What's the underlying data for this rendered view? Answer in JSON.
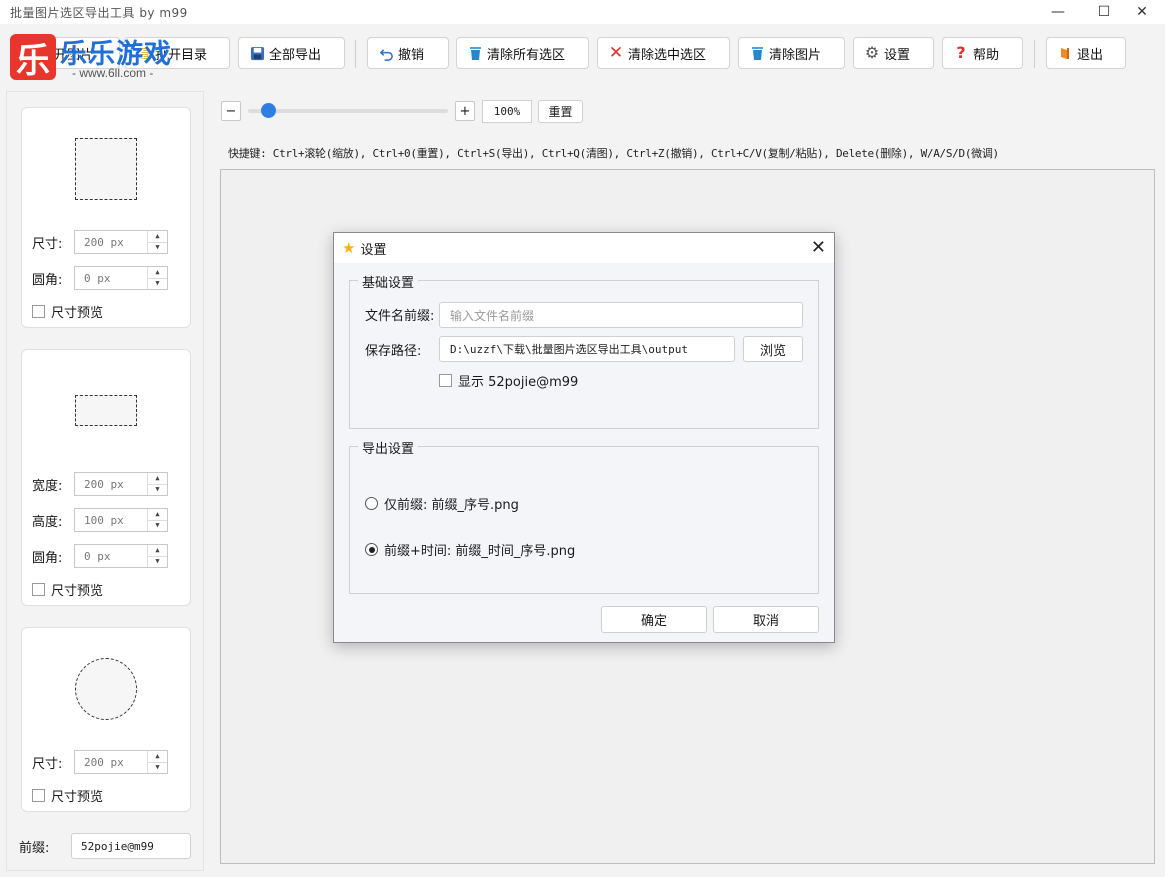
{
  "window": {
    "title": "批量图片选区导出工具 by m99",
    "minimize_glyph": "—",
    "maximize_glyph": "☐",
    "close_glyph": "✕"
  },
  "watermark": {
    "logo_char": "乐",
    "brand": "乐乐游戏",
    "url": "- www.6ll.com -"
  },
  "toolbar": {
    "buttons": [
      {
        "label": "打开图片",
        "icon": "folder-icon"
      },
      {
        "label": "打开目录",
        "icon": "folder-open-icon"
      },
      {
        "label": "全部导出",
        "icon": "save-icon"
      },
      {
        "label": "撤销",
        "icon": "undo-icon"
      },
      {
        "label": "清除所有选区",
        "icon": "trash-icon"
      },
      {
        "label": "清除选中选区",
        "icon": "x-icon"
      },
      {
        "label": "清除图片",
        "icon": "trash-icon"
      },
      {
        "label": "设置",
        "icon": "gear-icon"
      },
      {
        "label": "帮助",
        "icon": "question-icon"
      },
      {
        "label": "退出",
        "icon": "exit-icon"
      }
    ]
  },
  "sidebar": {
    "square": {
      "size_label": "尺寸:",
      "size_value": "200 px",
      "radius_label": "圆角:",
      "radius_value": "0 px",
      "preview_label": "尺寸预览",
      "preview_checked": false
    },
    "rect": {
      "width_label": "宽度:",
      "width_value": "200 px",
      "height_label": "高度:",
      "height_value": "100 px",
      "radius_label": "圆角:",
      "radius_value": "0 px",
      "preview_label": "尺寸预览",
      "preview_checked": false
    },
    "circle": {
      "size_label": "尺寸:",
      "size_value": "200 px",
      "preview_label": "尺寸预览",
      "preview_checked": false
    },
    "prefix_label": "前缀:",
    "prefix_value": "52pojie@m99"
  },
  "zoom": {
    "minus": "−",
    "plus": "+",
    "value": "100%",
    "level_fraction": 0.1,
    "reset_label": "重置"
  },
  "shortcuts": "快捷键: Ctrl+滚轮(缩放), Ctrl+0(重置), Ctrl+S(导出), Ctrl+Q(清图), Ctrl+Z(撤销), Ctrl+C/V(复制/粘贴), Delete(删除), W/A/S/D(微调)",
  "dialog": {
    "title": "设置",
    "close_glyph": "✕",
    "basic": {
      "group_title": "基础设置",
      "prefix_label": "文件名前缀:",
      "prefix_placeholder": "输入文件名前缀",
      "path_label": "保存路径:",
      "path_value": "D:\\uzzf\\下载\\批量图片选区导出工具\\output",
      "browse_label": "浏览",
      "show_label": "显示 52pojie@m99",
      "show_checked": false
    },
    "export": {
      "group_title": "导出设置",
      "options": [
        {
          "label": "仅前缀: 前缀_序号.png",
          "selected": false
        },
        {
          "label": "前缀+时间: 前缀_时间_序号.png",
          "selected": true
        }
      ]
    },
    "ok_label": "确定",
    "cancel_label": "取消"
  }
}
